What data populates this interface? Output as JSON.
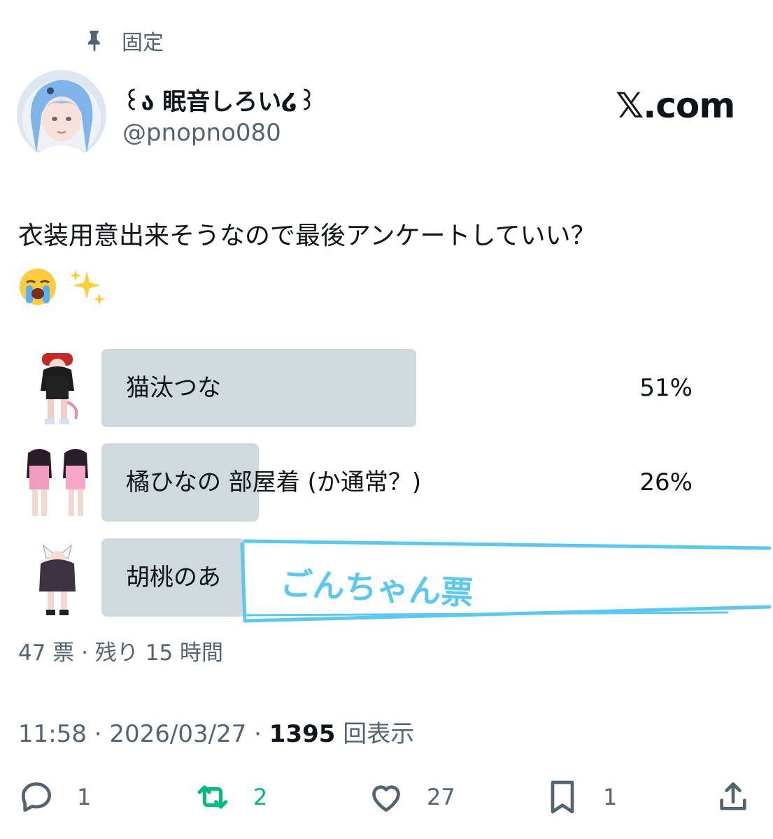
{
  "header": {
    "pinned_label": "固定"
  },
  "user": {
    "display_name": "꒰ა 眠音しろい໒꒱",
    "handle": "@pnopno080"
  },
  "brand": "𝕏.com",
  "tweet": {
    "line1": "衣装用意出来そうなので最後アンケートしていい？",
    "emojis": [
      "loudly-crying-face",
      "sparkles"
    ]
  },
  "poll": {
    "options": [
      {
        "label": "猫汰つな",
        "percent_text": "51%",
        "percent": 51
      },
      {
        "label": "橘ひなの 部屋着 (か通常？)",
        "percent_text": "26%",
        "percent": 26
      },
      {
        "label": "胡桃のあ",
        "percent_text": "",
        "percent": 23
      }
    ],
    "scribble_text": "ごんちゃん票",
    "meta": "47 票 · 残り 15 時間"
  },
  "timestamp": {
    "time_date": "11:58 · 2026/03/27 · ",
    "views": "1395",
    "views_label": " 回表示"
  },
  "actions": {
    "reply_count": "1",
    "retweet_count": "2",
    "like_count": "27",
    "bookmark_count": "1",
    "colors": {
      "retweet": "#00ba7c",
      "muted": "#536471",
      "poll_bar": "#cfd9de",
      "scribble": "#5bc8f0"
    }
  }
}
